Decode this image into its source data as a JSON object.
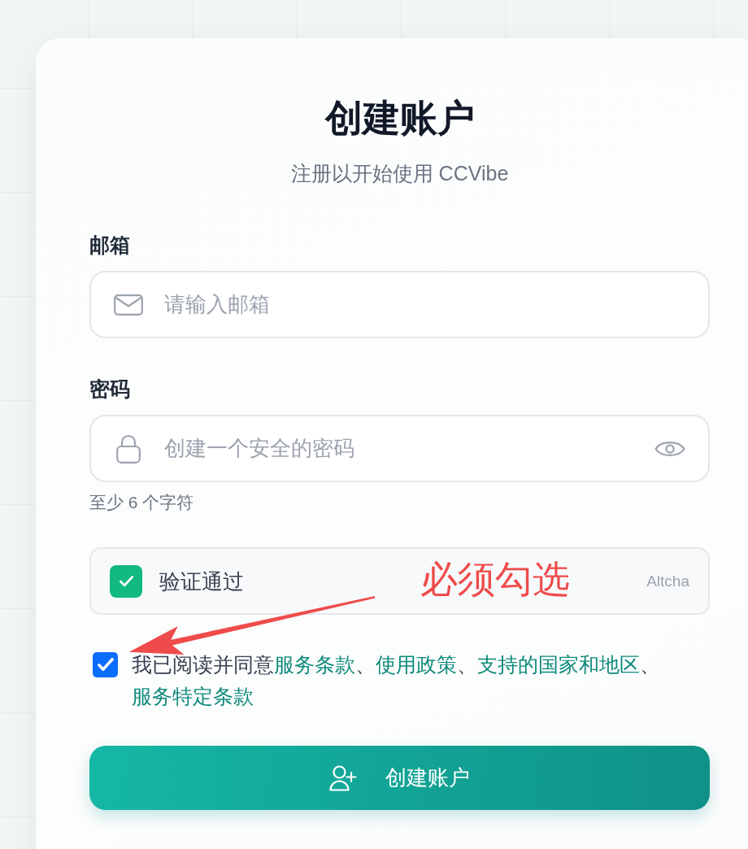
{
  "header": {
    "title": "创建账户",
    "subtitle": "注册以开始使用 CCVibe"
  },
  "fields": [
    {
      "kind": "email",
      "label": "邮箱",
      "placeholder": "请输入邮箱"
    },
    {
      "kind": "password",
      "label": "密码",
      "placeholder": "创建一个安全的密码",
      "hint": "至少 6 个字符"
    }
  ],
  "captcha": {
    "verified": true,
    "status": "验证通过",
    "provider": "Altcha"
  },
  "agreement": {
    "checked": true,
    "parts": [
      {
        "kind": "text",
        "text": "我已阅读并同意"
      },
      {
        "kind": "link",
        "text": "服务条款"
      },
      {
        "kind": "text",
        "text": "、"
      },
      {
        "kind": "link",
        "text": "使用政策"
      },
      {
        "kind": "text",
        "text": "、"
      },
      {
        "kind": "link",
        "text": "支持的国家和地区"
      },
      {
        "kind": "text",
        "text": "、"
      },
      {
        "kind": "link",
        "text": "服务特定条款"
      }
    ]
  },
  "submit_button": {
    "label": "创建账户"
  },
  "annotation": {
    "text": "必须勾选"
  }
}
